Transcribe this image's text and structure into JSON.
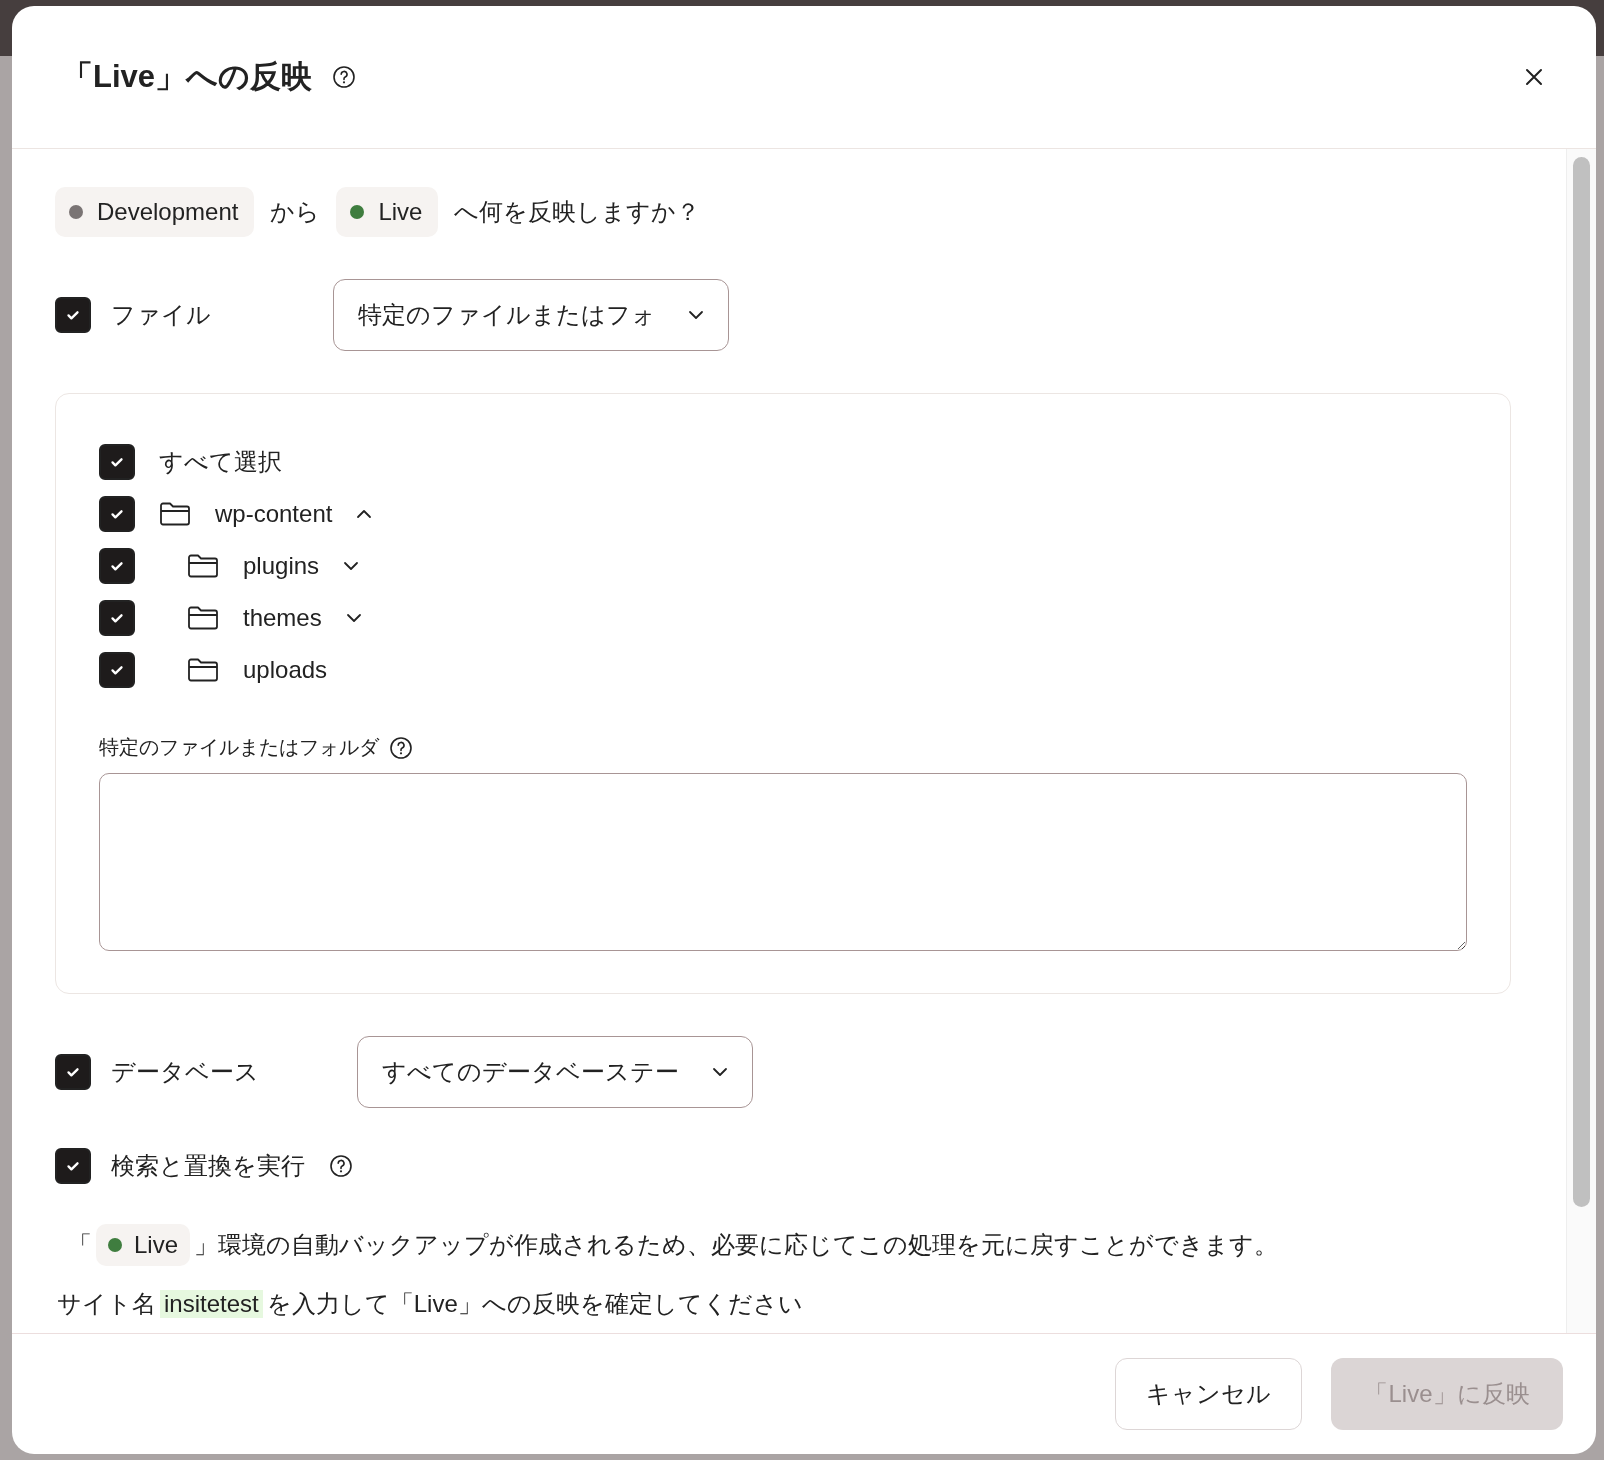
{
  "dialog": {
    "title": "「Live」への反映"
  },
  "source": {
    "label": "Development",
    "color": "#7a7474"
  },
  "connector": "から",
  "target": {
    "label": "Live",
    "color": "#3f7d3f"
  },
  "question": "へ何を反映しますか？",
  "files": {
    "label": "ファイル",
    "checked": true,
    "dropdown": "特定のファイルまたはフォ"
  },
  "file_tree": {
    "select_all": {
      "label": "すべて選択",
      "checked": true
    },
    "items": [
      {
        "name": "wp-content",
        "checked": true,
        "expanded": true,
        "children": [
          {
            "name": "plugins",
            "checked": true,
            "expanded": false
          },
          {
            "name": "themes",
            "checked": true,
            "expanded": false
          },
          {
            "name": "uploads",
            "checked": true
          }
        ]
      }
    ],
    "specific_label": "特定のファイルまたはフォルダ"
  },
  "database": {
    "label": "データベース",
    "checked": true,
    "dropdown": "すべてのデータベーステー"
  },
  "search_replace": {
    "label": "検索と置換を実行",
    "checked": true
  },
  "backup_note": {
    "prefix": "「",
    "env": "Live",
    "suffix": "」環境の自動バックアップが作成されるため、必要に応じてこの処理を元に戻すことができます。"
  },
  "confirm_note": {
    "before": "サイト名",
    "site": "insitetest",
    "after": "を入力して「Live」への反映を確定してください"
  },
  "buttons": {
    "cancel": "キャンセル",
    "submit": {
      "label": "「Live」に反映",
      "disabled": true
    }
  }
}
